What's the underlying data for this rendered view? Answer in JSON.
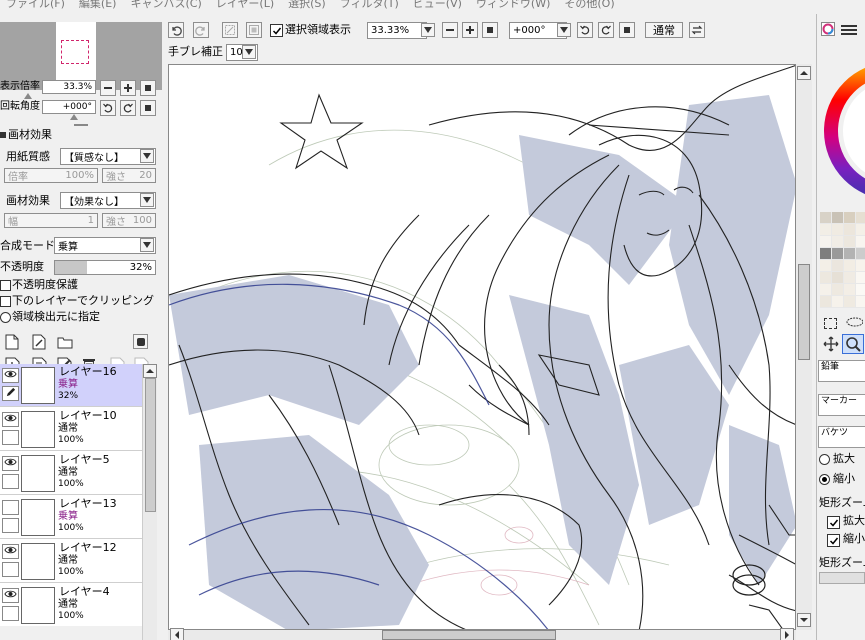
{
  "menu": [
    "ファイル(F)",
    "編集(E)",
    "キャンバス(C)",
    "レイヤー(L)",
    "選択(S)",
    "フィルタ(T)",
    "ビュー(V)",
    "ウィンドウ(W)",
    "その他(O)"
  ],
  "toolbar": {
    "select_display_label": "選択領域表示",
    "zoom_value": "33.33%",
    "rotation_value": "+000°",
    "blend_button_label": "通常",
    "stabilizer_label": "手ブレ補正",
    "stabilizer_value": "10"
  },
  "navigator": {
    "zoom_label": "表示倍率",
    "zoom_value": "33.3%",
    "rotation_label": "回転角度",
    "rotation_value": "+000°"
  },
  "texture_effects": {
    "header": "画材効果",
    "paper_label": "用紙質感",
    "paper_value": "【質感なし】",
    "paper_scale_label": "倍率",
    "paper_scale_value": "100%",
    "paper_strength_label": "強さ",
    "paper_strength_value": "20",
    "effect_label": "画材効果",
    "effect_value": "【効果なし】",
    "effect_width_label": "幅",
    "effect_width_value": "1",
    "effect_strength_label": "強さ",
    "effect_strength_value": "100"
  },
  "layer_props": {
    "blend_label": "合成モード",
    "blend_value": "乗算",
    "opacity_label": "不透明度",
    "opacity_value": "32%",
    "opacity_fraction": 0.32,
    "preserve_opacity_label": "不透明度保護",
    "clip_label": "下のレイヤーでクリッピング",
    "selection_source_label": "領域検出元に指定"
  },
  "layers": [
    {
      "name": "レイヤー16",
      "mode": "乗算",
      "opacity": "32%",
      "visible": true,
      "active": true
    },
    {
      "name": "レイヤー10",
      "mode": "通常",
      "opacity": "100%",
      "visible": true,
      "active": false
    },
    {
      "name": "レイヤー5",
      "mode": "通常",
      "opacity": "100%",
      "visible": true,
      "active": false
    },
    {
      "name": "レイヤー13",
      "mode": "乗算",
      "opacity": "100%",
      "visible": false,
      "active": false
    },
    {
      "name": "レイヤー12",
      "mode": "通常",
      "opacity": "100%",
      "visible": true,
      "active": false
    },
    {
      "name": "レイヤー4",
      "mode": "通常",
      "opacity": "100%",
      "visible": true,
      "active": false
    }
  ],
  "right_panel": {
    "tools": [
      "鉛筆",
      "マーカー",
      "バケツ"
    ],
    "zoom_in_label": "拡大",
    "zoom_out_label": "縮小",
    "rect_zoom_label": "矩形ズーム",
    "rect_zoom_in_label": "拡大",
    "rect_zoom_out_label": "縮小",
    "rect_zoom_label2": "矩形ズーム"
  },
  "swatch_colors": [
    "#d8d2c7",
    "#c9c2b6",
    "#d8cfbf",
    "#e6dfd2",
    "#f2eee6",
    "#f0ebe2",
    "#ece6dc",
    "#f4f0e8",
    "#f6f3ee",
    "#f1ede6",
    "#ece7de",
    "#f8f5f0",
    "#7e7e7e",
    "#9a9a9a",
    "#b3b3b3",
    "#cccccc",
    "#f3efe7",
    "#ebe6de",
    "#f2ede4",
    "#f7f3ec",
    "#ede8df",
    "#e6e0d6",
    "#f0ebe3",
    "#faf7f2",
    "#f5f1ea",
    "#eee9e0",
    "#f3eee6",
    "#fbf9f5",
    "#ece7de",
    "#f6f2eb",
    "#efeae1",
    "#f9f6f1"
  ]
}
